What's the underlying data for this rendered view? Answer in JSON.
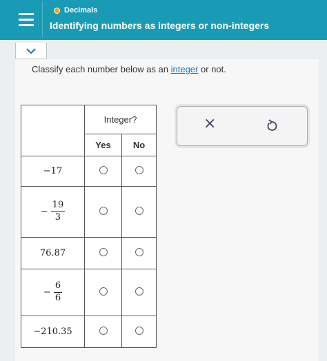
{
  "header": {
    "topic": "Decimals",
    "title": "Identifying numbers as integers or non-integers"
  },
  "question": {
    "prefix": "Classify each number below as an ",
    "link_text": "integer",
    "suffix": " or not."
  },
  "table": {
    "group_header": "Integer?",
    "columns": [
      "Yes",
      "No"
    ],
    "rows": [
      {
        "text": "−17"
      },
      {
        "sign": "−",
        "numerator": "19",
        "denominator": "3"
      },
      {
        "text": "76.87"
      },
      {
        "sign": "−",
        "numerator": "6",
        "denominator": "6"
      },
      {
        "text": "−210.35"
      }
    ]
  },
  "tools": {
    "clear_glyph": "×"
  },
  "colors": {
    "header_bg": "#1a9bb5",
    "topic_dot": "#f2a21b",
    "link": "#1a73c9"
  },
  "icons": [
    "menu-icon",
    "chevron-down-icon",
    "close-icon",
    "undo-icon"
  ]
}
